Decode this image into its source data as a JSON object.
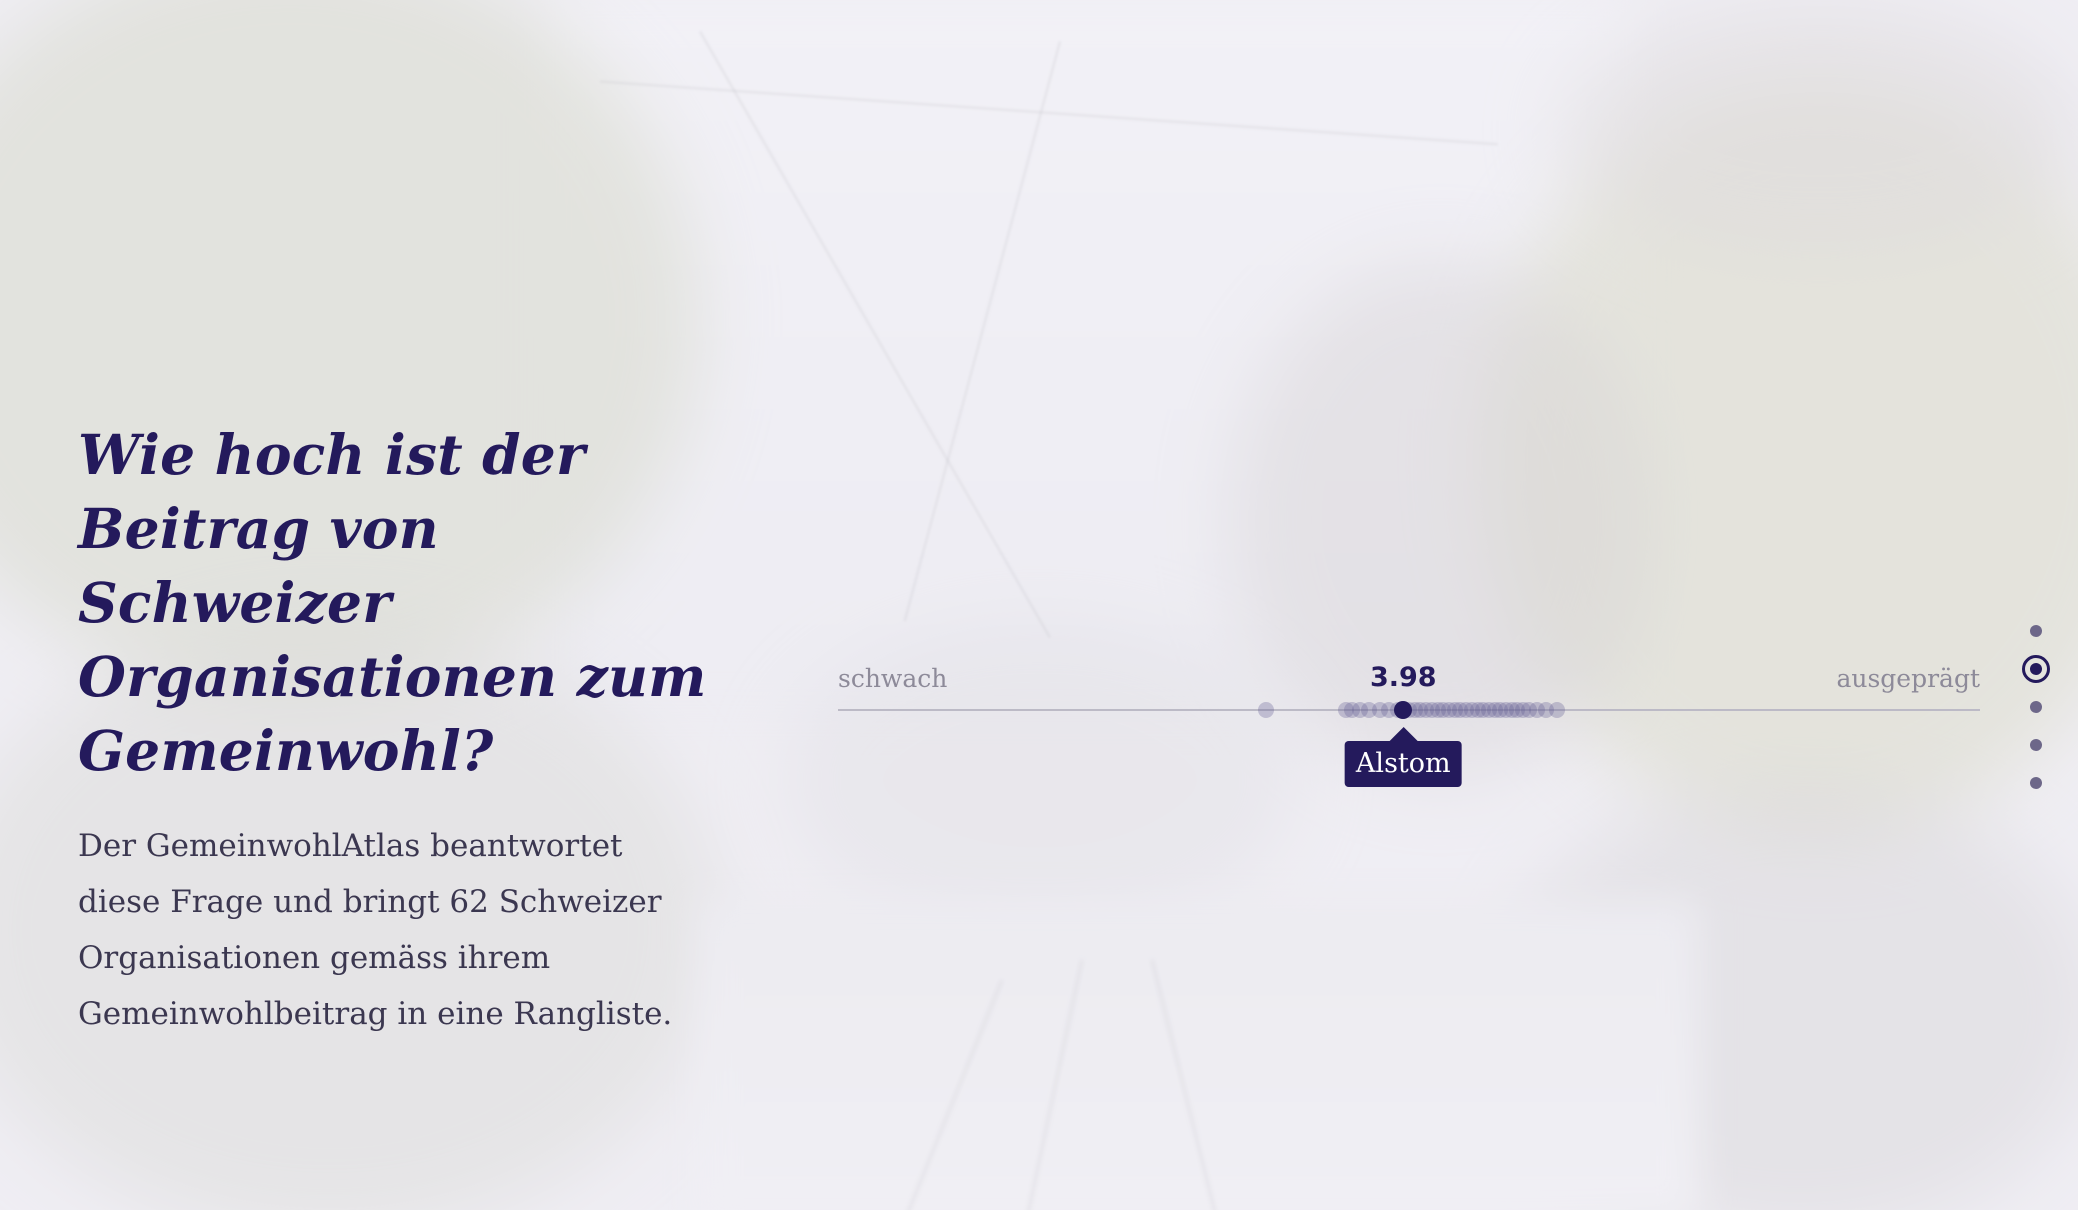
{
  "hero": {
    "headline": "Wie hoch ist der Beitrag von Schweizer Organisationen zum Gemeinwohl?",
    "intro": "Der GemeinwohlAtlas beantwortet diese Frage und bringt 62 Schweizer Organisationen gemäss ihrem Gemeinwohlbeitrag in eine Rangliste."
  },
  "scale": {
    "label_low": "schwach",
    "label_high": "ausgeprägt",
    "selected": {
      "name": "Alstom",
      "value_text": "3.98",
      "value": 3.98
    },
    "range": [
      2.0,
      6.0
    ],
    "points": [
      3.5,
      3.78,
      3.8,
      3.83,
      3.86,
      3.9,
      3.93,
      3.96,
      3.98,
      4.0,
      4.02,
      4.04,
      4.06,
      4.08,
      4.1,
      4.12,
      4.14,
      4.16,
      4.18,
      4.2,
      4.22,
      4.24,
      4.26,
      4.28,
      4.3,
      4.32,
      4.34,
      4.36,
      4.38,
      4.4,
      4.42,
      4.45,
      4.48,
      4.52
    ],
    "colors": {
      "accent": "#241a5c",
      "point": "#6860968f",
      "axis": "#bcbac6"
    }
  },
  "side_nav": {
    "items": [
      {
        "icon": "dot",
        "active": false
      },
      {
        "icon": "dot",
        "active": true
      },
      {
        "icon": "dot",
        "active": false
      },
      {
        "icon": "dot",
        "active": false
      },
      {
        "icon": "dot",
        "active": false
      }
    ]
  }
}
